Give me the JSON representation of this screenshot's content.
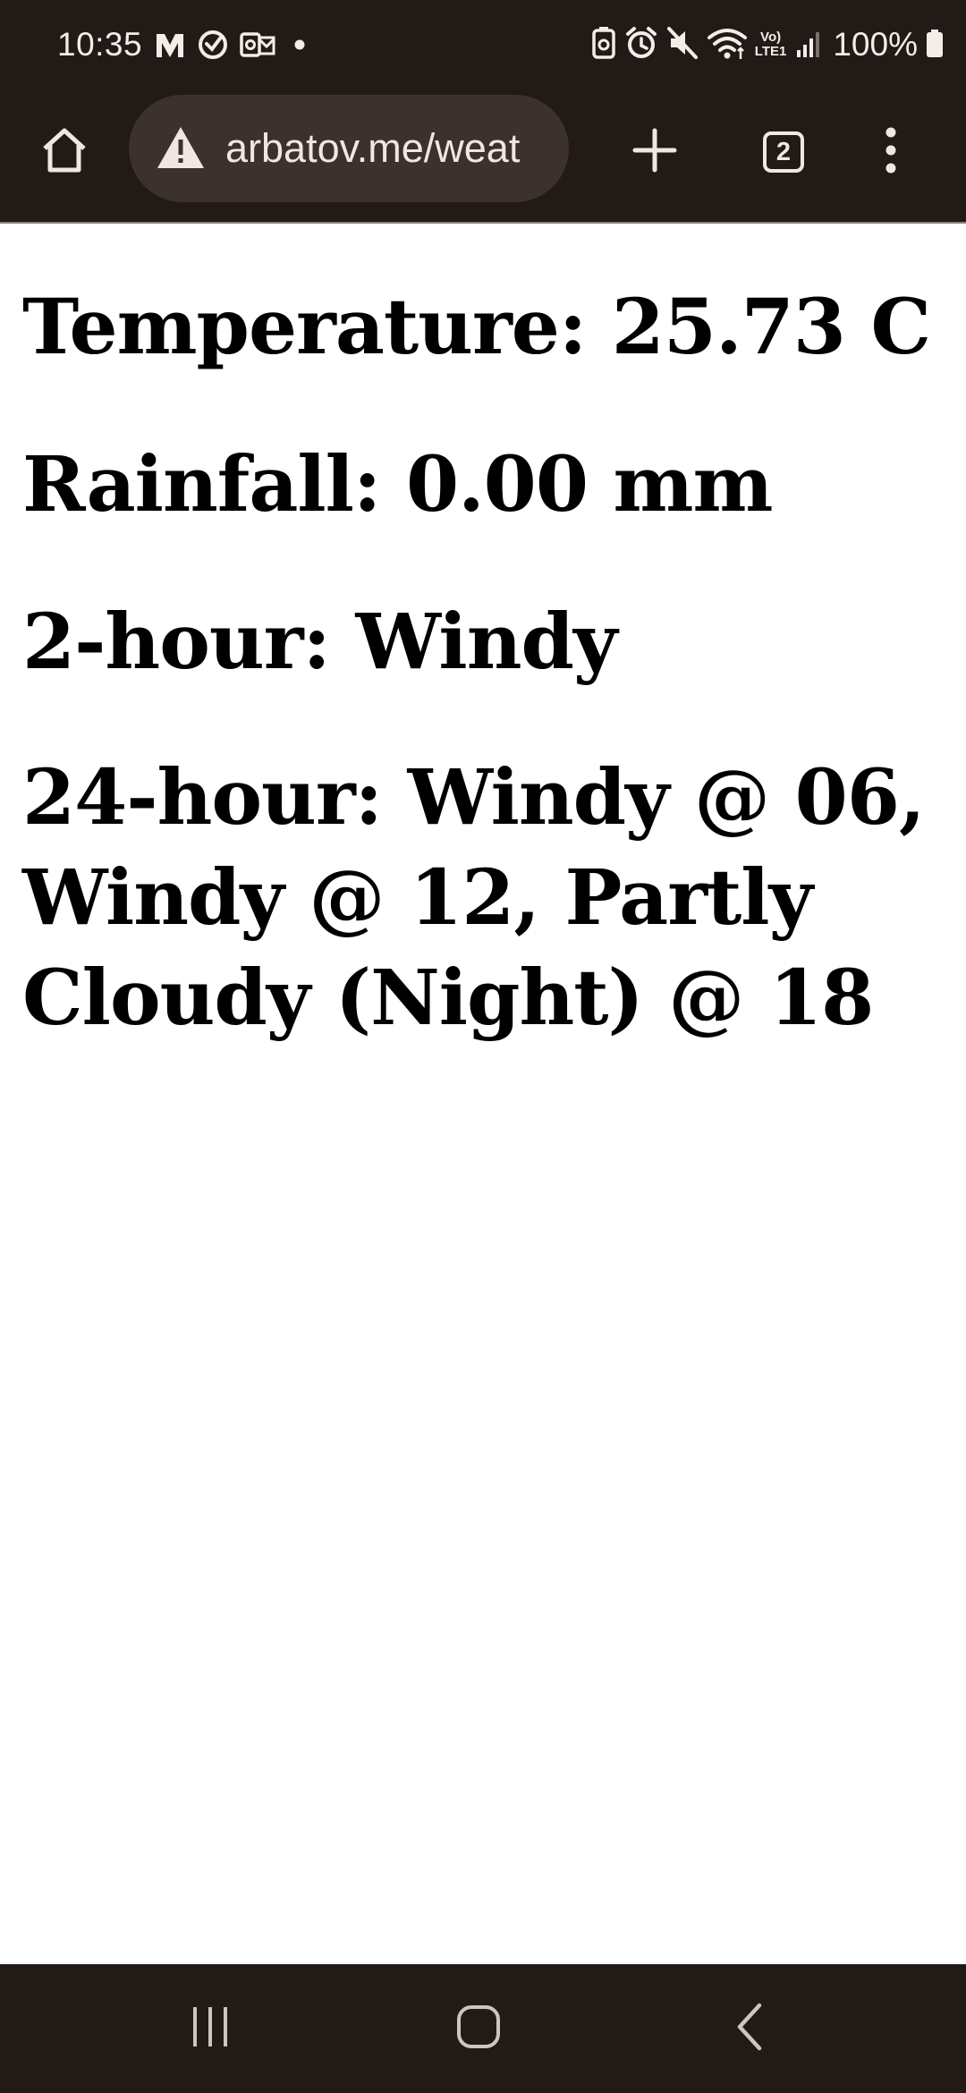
{
  "status_bar": {
    "time": "10:35",
    "battery": "100%",
    "left_icons": [
      "m-logo-icon",
      "sync-circle-icon",
      "outlook-icon",
      "dot-icon"
    ],
    "right_icons": [
      "battery-saver-icon",
      "alarm-icon",
      "mute-icon",
      "wifi-icon",
      "volte-lte-icon",
      "signal-icon",
      "battery-icon"
    ],
    "volte_label_top": "Vo)",
    "volte_label_bottom": "LTE1"
  },
  "browser": {
    "url": "arbatov.me/weat",
    "tab_count": "2",
    "icons": [
      "home-icon",
      "warning-icon",
      "plus-icon",
      "tabs-icon",
      "more-vert-icon"
    ]
  },
  "content": {
    "temperature": "Temperature: 25.73 C",
    "rainfall": "Rainfall: 0.00 mm",
    "two_hour": "2-hour: Windy",
    "forecast_24": "24-hour: Windy @ 06, Windy @ 12, Partly Cloudy (Night) @ 18"
  },
  "nav_bar": {
    "icons": [
      "recents-icon",
      "home-circle-icon",
      "back-icon"
    ]
  },
  "colors": {
    "chrome_bg": "#211a17",
    "url_bar_bg": "#3c312c",
    "chrome_fg": "#f1e6e1",
    "page_bg": "#ffffff",
    "text": "#000000"
  }
}
